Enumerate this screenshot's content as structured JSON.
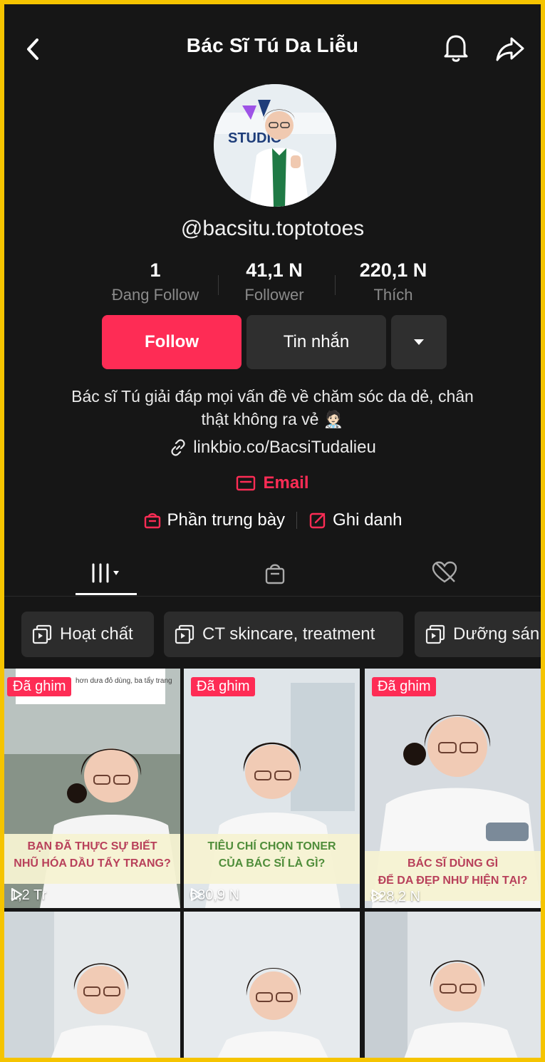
{
  "header": {
    "title": "Bác Sĩ Tú Da Liễu"
  },
  "profile": {
    "handle": "@bacsitu.toptotoes",
    "avatar_text": "STUDIO"
  },
  "stats": [
    {
      "value": "1",
      "label": "Đang Follow"
    },
    {
      "value": "41,1 N",
      "label": "Follower"
    },
    {
      "value": "220,1 N",
      "label": "Thích"
    }
  ],
  "actions": {
    "follow": "Follow",
    "message": "Tin nhắn"
  },
  "bio": {
    "line1": "Bác sĩ Tú giải đáp mọi vấn đề về chăm sóc da dẻ, chân",
    "line2": "thật không ra vẻ 🧑🏻‍⚕️"
  },
  "link": "linkbio.co/BacsiTudalieu",
  "email": "Email",
  "extras": {
    "showcase": "Phần trưng bày",
    "signup": "Ghi danh"
  },
  "playlists": [
    "Hoạt chất",
    "CT skincare, treatment",
    "Dưỡng sán"
  ],
  "videos": [
    {
      "pin": "Đã ghim",
      "caption1": "BẠN ĐÃ THỰC SỰ BIẾT",
      "caption2": "NHŨ HÓA DẦU TẨY TRANG?",
      "views": "1,2 Tr",
      "top_note": "hơn dưa đỏ dùng, ba tẩy trang"
    },
    {
      "pin": "Đã ghim",
      "caption1": "TIÊU CHÍ CHỌN TONER",
      "caption2": "CỦA BÁC SĨ LÀ GÌ?",
      "views": "630,9 N"
    },
    {
      "pin": "Đã ghim",
      "caption1": "BÁC SĨ DÙNG GÌ",
      "caption2": "ĐỂ DA ĐẸP NHƯ HIỆN TẠI?",
      "views": "828,2 N"
    }
  ],
  "colors": {
    "accent": "#fe2c55",
    "background": "#161616",
    "frame": "#f5c400"
  },
  "icons": [
    "back-icon",
    "bell-icon",
    "share-icon",
    "link-icon",
    "mail-icon",
    "bag-icon",
    "edit-icon",
    "grid-icon",
    "shop-icon",
    "liked-icon",
    "playlist-icon",
    "play-icon"
  ]
}
